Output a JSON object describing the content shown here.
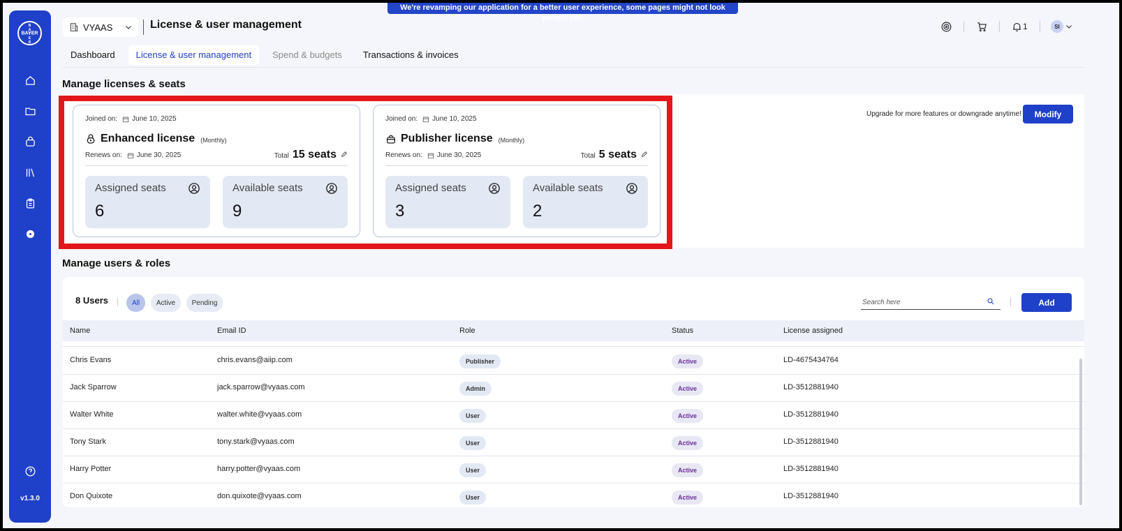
{
  "banner": {
    "text": "We're revamping our application for a better user experience, some pages might not look perfect yet!"
  },
  "sidebar": {
    "logo_text": "BAYER",
    "version": "v1.3.0",
    "items": [
      {
        "name": "home-icon"
      },
      {
        "name": "folder-icon"
      },
      {
        "name": "bag-icon"
      },
      {
        "name": "library-icon"
      },
      {
        "name": "clipboard-icon"
      },
      {
        "name": "gear-icon"
      }
    ],
    "help_icon": "help-icon"
  },
  "header": {
    "org": "VYAAS",
    "title": "License & user management",
    "notifications_count": "1",
    "avatar_initials": "SI"
  },
  "tabs": [
    {
      "label": "Dashboard"
    },
    {
      "label": "License & user management"
    },
    {
      "label": "Spend & budgets"
    },
    {
      "label": "Transactions & invoices"
    }
  ],
  "licenses": {
    "section_title": "Manage licenses & seats",
    "upgrade_text": "Upgrade for more features or downgrade anytime!",
    "modify_label": "Modify",
    "cards": [
      {
        "joined_label": "Joined on:",
        "joined_date": "June 10, 2025",
        "name": "Enhanced license",
        "period": "(Monthly)",
        "renews_label": "Renews on:",
        "renews_date": "June 30, 2025",
        "total_label": "Total",
        "total_value": "15 seats",
        "assigned_label": "Assigned seats",
        "assigned_value": "6",
        "available_label": "Available seats",
        "available_value": "9"
      },
      {
        "joined_label": "Joined on:",
        "joined_date": "June 10, 2025",
        "name": "Publisher license",
        "period": "(Monthly)",
        "renews_label": "Renews on:",
        "renews_date": "June 30, 2025",
        "total_label": "Total",
        "total_value": "5 seats",
        "assigned_label": "Assigned seats",
        "assigned_value": "3",
        "available_label": "Available seats",
        "available_value": "2"
      }
    ]
  },
  "users": {
    "section_title": "Manage users & roles",
    "count_label": "8 Users",
    "filters": [
      "All",
      "Active",
      "Pending"
    ],
    "search_placeholder": "Search here",
    "add_label": "Add",
    "columns": [
      "Name",
      "Email ID",
      "Role",
      "Status",
      "License assigned"
    ],
    "rows": [
      {
        "name": "Chris Evans",
        "email": "chris.evans@aiip.com",
        "role": "Publisher",
        "status": "Active",
        "license": "LD-4675434764"
      },
      {
        "name": "Jack Sparrow",
        "email": "jack.sparrow@vyaas.com",
        "role": "Admin",
        "status": "Active",
        "license": "LD-3512881940"
      },
      {
        "name": "Walter White",
        "email": "walter.white@vyaas.com",
        "role": "User",
        "status": "Active",
        "license": "LD-3512881940"
      },
      {
        "name": "Tony Stark",
        "email": "tony.stark@vyaas.com",
        "role": "User",
        "status": "Active",
        "license": "LD-3512881940"
      },
      {
        "name": "Harry Potter",
        "email": "harry.potter@vyaas.com",
        "role": "User",
        "status": "Active",
        "license": "LD-3512881940"
      },
      {
        "name": "Don Quixote",
        "email": "don.quixote@vyaas.com",
        "role": "User",
        "status": "Active",
        "license": "LD-3512881940"
      }
    ]
  },
  "colors": {
    "primary": "#1f40c9",
    "highlight": "#e3171b",
    "status_text": "#6a2e9a"
  }
}
